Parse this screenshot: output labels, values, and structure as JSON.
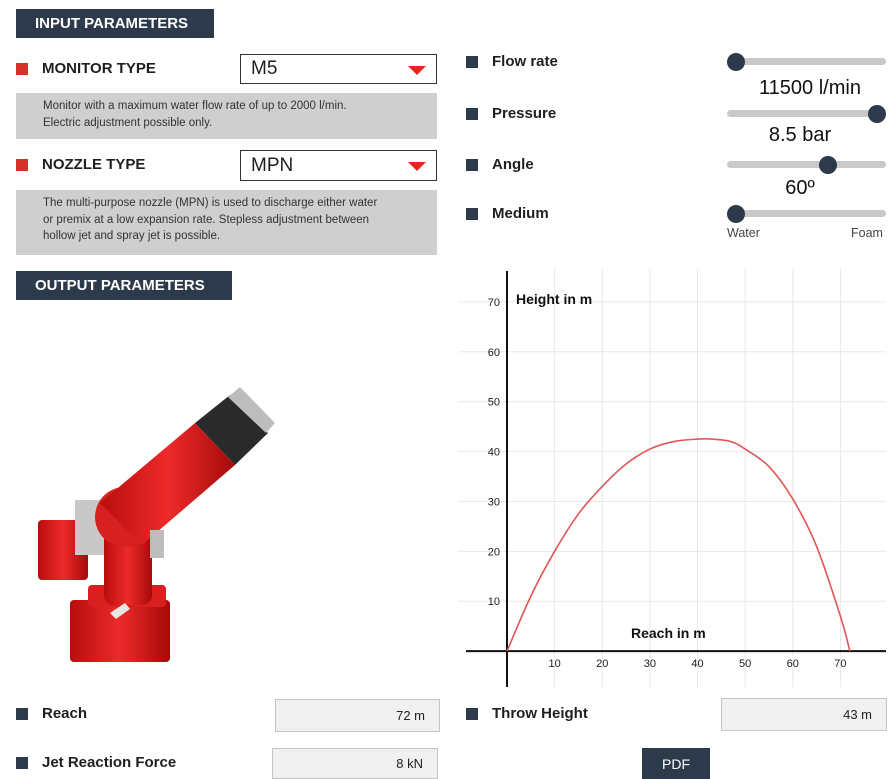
{
  "input_section": {
    "title": "INPUT PARAMETERS"
  },
  "monitor": {
    "label": "MONITOR TYPE",
    "value": "M5",
    "description_line1": "Monitor with a maximum water flow rate of up to 2000 l/min.",
    "description_line2": "Electric adjustment possible only."
  },
  "nozzle": {
    "label": "NOZZLE TYPE",
    "value": "MPN",
    "description_line1": "The multi-purpose nozzle (MPN) is used to discharge either water",
    "description_line2": "or premix at a low expansion rate. Stepless adjustment between",
    "description_line3": "hollow jet and spray jet is possible."
  },
  "sliders": {
    "flow": {
      "label": "Flow rate",
      "value_text": "11500 l/min",
      "level": 0.0
    },
    "pressure": {
      "label": "Pressure",
      "value_text": "8.5 bar",
      "level": 1.0
    },
    "angle": {
      "label": "Angle",
      "value_text": "60º",
      "level": 0.65
    },
    "medium": {
      "label": "Medium",
      "min_label": "Water",
      "max_label": "Foam",
      "level": 0.0
    }
  },
  "output_section": {
    "title": "OUTPUT PARAMETERS"
  },
  "outputs": {
    "reach": {
      "label": "Reach",
      "value": "72 m"
    },
    "throw_height": {
      "label": "Throw Height",
      "value": "43 m"
    },
    "jet_force": {
      "label": "Jet Reaction Force",
      "value": "8 kN"
    }
  },
  "pdf_button": {
    "label": "PDF"
  },
  "colors": {
    "navy": "#2c3a4b",
    "red": "#d8312b",
    "curve": "#e05555"
  },
  "chart_data": {
    "type": "line",
    "xlabel": "Reach in m",
    "ylabel": "Height in m",
    "x_ticks": [
      10,
      20,
      30,
      40,
      50,
      60,
      70
    ],
    "y_ticks": [
      10,
      20,
      30,
      40,
      50,
      60,
      70
    ],
    "xlim": [
      0,
      80
    ],
    "ylim": [
      -8,
      77
    ],
    "grid": true,
    "series": [
      {
        "x": [
          0,
          5,
          10,
          15,
          20,
          25,
          30,
          35,
          40,
          43,
          47,
          50,
          55,
          60,
          65,
          70,
          72
        ],
        "y": [
          0,
          11,
          20,
          27.5,
          33,
          37.5,
          40.5,
          42,
          42.5,
          42.5,
          42,
          40.5,
          37,
          30.5,
          21,
          7,
          0
        ]
      }
    ]
  }
}
